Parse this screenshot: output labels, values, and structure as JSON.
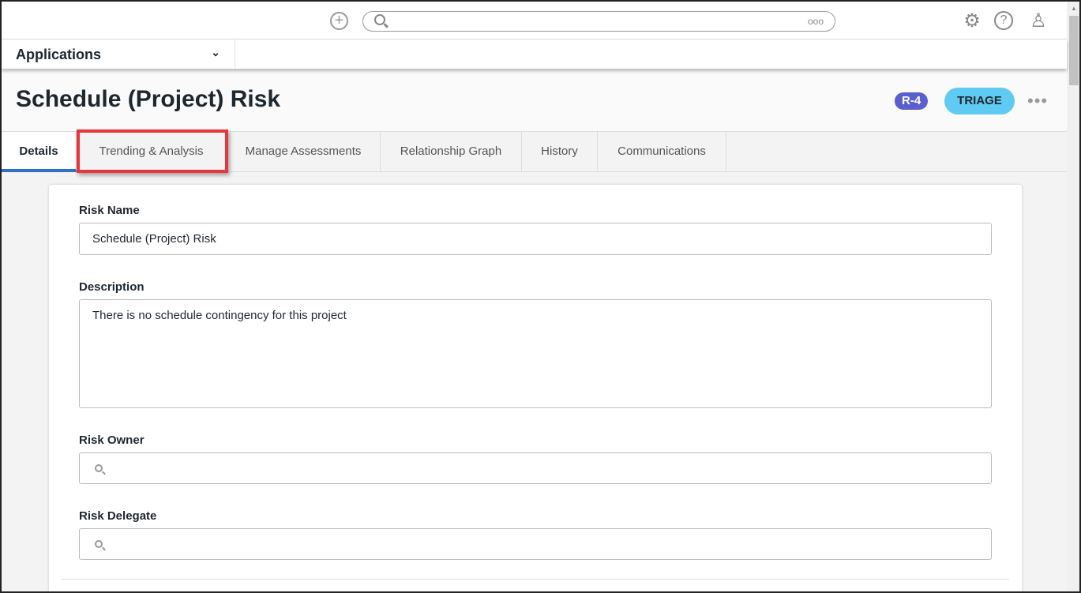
{
  "topbar": {
    "more_dots": "ooo"
  },
  "app_selector": {
    "label": "Applications"
  },
  "record": {
    "title": "Schedule (Project) Risk",
    "id_badge": "R-4",
    "status": "TRIAGE",
    "colors": {
      "badge": "#5a5fcf",
      "status": "#5fcbf2",
      "highlight": "#e8363c"
    }
  },
  "tabs": [
    {
      "label": "Details"
    },
    {
      "label": "Trending & Analysis"
    },
    {
      "label": "Manage Assessments"
    },
    {
      "label": "Relationship Graph"
    },
    {
      "label": "History"
    },
    {
      "label": "Communications"
    }
  ],
  "form": {
    "risk_name": {
      "label": "Risk Name",
      "value": "Schedule (Project) Risk"
    },
    "description": {
      "label": "Description",
      "value": "There is no schedule contingency for this project"
    },
    "risk_owner": {
      "label": "Risk Owner"
    },
    "risk_delegate": {
      "label": "Risk Delegate"
    }
  }
}
